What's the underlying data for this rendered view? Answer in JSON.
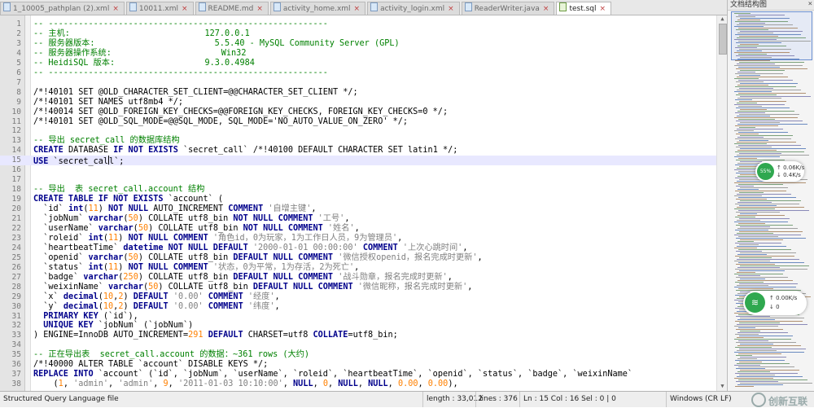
{
  "tabs": [
    {
      "label": "1_10005_pathplan (2).xml",
      "active": false
    },
    {
      "label": "10011.xml",
      "active": false
    },
    {
      "label": "README.md",
      "active": false
    },
    {
      "label": "activity_home.xml",
      "active": false
    },
    {
      "label": "activity_login.xml",
      "active": false
    },
    {
      "label": "ReaderWriter.java",
      "active": false
    },
    {
      "label": "test.sql",
      "active": true
    }
  ],
  "editor": {
    "current_line": 16,
    "lines": [
      {
        "n": "1",
        "code": "<span class=\"c\">-- --------------------------------------------------------</span>"
      },
      {
        "n": "2",
        "code": "<span class=\"c\">-- 主机:                           127.0.0.1</span>"
      },
      {
        "n": "3",
        "code": "<span class=\"c\">-- 服务器版本:                        5.5.40 - MySQL Community Server (GPL)</span>"
      },
      {
        "n": "4",
        "code": "<span class=\"c\">-- 服务器操作系统:                      Win32</span>"
      },
      {
        "n": "5",
        "code": "<span class=\"c\">-- HeidiSQL 版本:                  9.3.0.4984</span>"
      },
      {
        "n": "6",
        "code": "<span class=\"c\">-- --------------------------------------------------------</span>"
      },
      {
        "n": "7",
        "code": ""
      },
      {
        "n": "8",
        "code": "/*!40101 SET @OLD_CHARACTER_SET_CLIENT=@@CHARACTER_SET_CLIENT */;"
      },
      {
        "n": "9",
        "code": "/*!40101 SET NAMES utf8mb4 */;"
      },
      {
        "n": "10",
        "code": "/*!40014 SET @OLD_FOREIGN_KEY_CHECKS=@@FOREIGN_KEY_CHECKS, FOREIGN_KEY_CHECKS=0 */;"
      },
      {
        "n": "11",
        "code": "/*!40101 SET @OLD_SQL_MODE=@@SQL_MODE, SQL_MODE='NO_AUTO_VALUE_ON_ZERO' */;"
      },
      {
        "n": "12",
        "code": ""
      },
      {
        "n": "13",
        "code": "<span class=\"c\">-- 导出 secret_call 的数据库结构</span>"
      },
      {
        "n": "14",
        "code": "<span class=\"kw\">CREATE</span> DATABASE <span class=\"kw\">IF NOT EXISTS</span> `secret_call` /*!40100 DEFAULT CHARACTER SET latin1 */;"
      },
      {
        "n": "15",
        "code": "<span class=\"kw\">USE</span> `secret_cal<span class=\"cursor\"></span>l`;"
      },
      {
        "n": "16",
        "code": ""
      },
      {
        "n": "17",
        "code": ""
      },
      {
        "n": "18",
        "code": "<span class=\"c\">-- 导出  表 secret_call.account 结构</span>"
      },
      {
        "n": "19",
        "code": "<span class=\"kw\">CREATE TABLE IF NOT EXISTS</span> `account` ("
      },
      {
        "n": "20",
        "code": "  `id` <span class=\"kw\">int</span>(<span class=\"n\">11</span>) <span class=\"kw\">NOT NULL</span> AUTO_INCREMENT <span class=\"kw\">COMMENT</span> <span class=\"s\">'自增主键'</span>,"
      },
      {
        "n": "21",
        "code": "  `jobNum` <span class=\"kw\">varchar</span>(<span class=\"n\">50</span>) COLLATE utf8_bin <span class=\"kw\">NOT NULL COMMENT</span> <span class=\"s\">'工号'</span>,"
      },
      {
        "n": "22",
        "code": "  `userName` <span class=\"kw\">varchar</span>(<span class=\"n\">50</span>) COLLATE utf8_bin <span class=\"kw\">NOT NULL COMMENT</span> <span class=\"s\">'姓名'</span>,"
      },
      {
        "n": "23",
        "code": "  `roleid` <span class=\"kw\">int</span>(<span class=\"n\">11</span>) <span class=\"kw\">NOT NULL COMMENT</span> <span class=\"s\">'角色id，0为玩家，1为工作日人员，9为管理员'</span>,"
      },
      {
        "n": "24",
        "code": "  `heartbeatTime` <span class=\"kw\">datetime NOT NULL DEFAULT</span> <span class=\"s\">'2000-01-01 00:00:00'</span> <span class=\"kw\">COMMENT</span> <span class=\"s\">'上次心跳时间'</span>,"
      },
      {
        "n": "25",
        "code": "  `openid` <span class=\"kw\">varchar</span>(<span class=\"n\">50</span>) COLLATE utf8_bin <span class=\"kw\">DEFAULT NULL COMMENT</span> <span class=\"s\">'微信授权openid，报名完成时更新'</span>,"
      },
      {
        "n": "26",
        "code": "  `status` <span class=\"kw\">int</span>(<span class=\"n\">11</span>) <span class=\"kw\">NOT NULL COMMENT</span> <span class=\"s\">'状态，0为平常，1为存活，2为死亡'</span>,"
      },
      {
        "n": "27",
        "code": "  `badge` <span class=\"kw\">varchar</span>(<span class=\"n\">250</span>) COLLATE utf8_bin <span class=\"kw\">DEFAULT NULL COMMENT</span> <span class=\"s\">'战斗勋章，报名完成时更新'</span>,"
      },
      {
        "n": "28",
        "code": "  `weixinName` <span class=\"kw\">varchar</span>(<span class=\"n\">50</span>) COLLATE utf8_bin <span class=\"kw\">DEFAULT NULL COMMENT</span> <span class=\"s\">'微信昵称，报名完成时更新'</span>,"
      },
      {
        "n": "29",
        "code": "  `x` <span class=\"kw\">decimal</span>(<span class=\"n\">10</span>,<span class=\"n\">2</span>) <span class=\"kw\">DEFAULT</span> <span class=\"s\">'0.00'</span> <span class=\"kw\">COMMENT</span> <span class=\"s\">'经度'</span>,"
      },
      {
        "n": "30",
        "code": "  `y` <span class=\"kw\">decimal</span>(<span class=\"n\">10</span>,<span class=\"n\">2</span>) <span class=\"kw\">DEFAULT</span> <span class=\"s\">'0.00'</span> <span class=\"kw\">COMMENT</span> <span class=\"s\">'纬度'</span>,"
      },
      {
        "n": "31",
        "code": "  <span class=\"kw\">PRIMARY KEY</span> (`id`),"
      },
      {
        "n": "32",
        "code": "  <span class=\"kw\">UNIQUE KEY</span> `jobNum` (`jobNum`)"
      },
      {
        "n": "33",
        "code": ") ENGINE=InnoDB AUTO_INCREMENT=<span class=\"n\">291</span> <span class=\"kw\">DEFAULT</span> CHARSET=utf8 <span class=\"kw\">COLLATE</span>=utf8_bin;"
      },
      {
        "n": "34",
        "code": ""
      },
      {
        "n": "35",
        "code": "<span class=\"c\">-- 正在导出表  secret_call.account 的数据：~361 rows (大约)</span>"
      },
      {
        "n": "36",
        "code": "/*!40000 ALTER TABLE `account` DISABLE KEYS */;"
      },
      {
        "n": "37",
        "code": "<span class=\"kw\">REPLACE INTO</span> `account` (`id`, `jobNum`, `userName`, `roleid`, `heartbeatTime`, `openid`, `status`, `badge`, `weixinName`"
      },
      {
        "n": "38",
        "code": "    (<span class=\"n\">1</span>, <span class=\"s\">'admin'</span>, <span class=\"s\">'admin'</span>, <span class=\"n\">9</span>, <span class=\"s\">'2011-01-03 10:10:00'</span>, <span class=\"kw\">NULL</span>, <span class=\"n\">0</span>, <span class=\"kw\">NULL</span>, <span class=\"kw\">NULL</span>, <span class=\"n\">0.00</span>, <span class=\"n\">0.00</span>),"
      }
    ]
  },
  "docmap": {
    "title": "文档结构图",
    "close": "×"
  },
  "speed_widget_small": {
    "percent": "55%",
    "up": "0.06K/s",
    "down": "0.4K/s"
  },
  "speed_widget_large": {
    "up": "0.00K/s",
    "down": "0"
  },
  "statusbar": {
    "filetype": "Structured Query Language file",
    "length": "length : 33,012",
    "lines": "lines : 376",
    "position": "Ln : 15    Col : 16    Sel : 0 | 0",
    "eol": "Windows (CR LF)",
    "watermark": "创新互联"
  }
}
